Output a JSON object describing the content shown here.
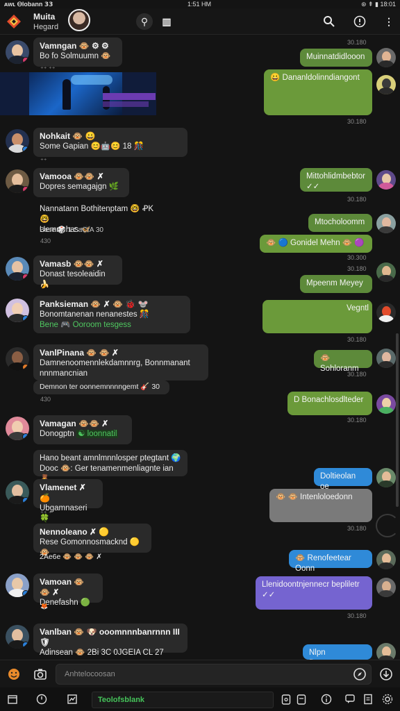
{
  "status": {
    "left": "ᴀᴡʟ Ꮎlobann 𝟯𝟯",
    "center": "1:51 ΗΜ",
    "right": "⊛ ⇞ ▮ 18:01"
  },
  "header": {
    "title": "Muita",
    "subtitle": "Hegard"
  },
  "incoming": [
    {
      "name": "Vamngan 🐵 ⚙ ⚙",
      "text": "Bo fo Solmuumn 🐵",
      "meta": "⁺⁺ ⁺⁺"
    },
    {
      "name": "Nohkait 🐵 😀",
      "text": "Some Gapian 😊🤖😊 18 🎊",
      "meta": "⁺⁺"
    },
    {
      "name": "Vamooa 🐵🐵 ✗",
      "text": "Dopres semagajgn 🌿",
      "meta": ""
    },
    {
      "name": "Nannatann Bothitenptam 🤓 ꝒK 🤓",
      "text": "Uemre has 🦋",
      "extra": "Base 🎲 1 SaCrA 30",
      "meta": "430"
    },
    {
      "name": "Vamasb 🐵🐵 ✗",
      "text": "Donast tesoleaidin 🍌",
      "meta": ""
    },
    {
      "name": "Panksieman 🐵 ✗ 🐵 🐞 🐭",
      "text": "Bonomtanenan nenanestes 🎊",
      "link": "Bene 🎮 Ooroom tesgess",
      "meta": ""
    },
    {
      "name": "VanlPinana 🐵 🐵 ✗",
      "text": "Damnenoomennlekdamnnrg, Bonnmanant",
      "text2": "nnnmancnian",
      "extra": "Demnon ter oonnemnnnngemt 🎸 30",
      "meta": "430"
    },
    {
      "name": "Vamagan 🐵🐵 ✗",
      "text": "Donogptn",
      "link": "☯ loonnatil",
      "meta": ""
    },
    {
      "name": "",
      "text": "Hano beant amnlmnnlosper ptegtant 🌍",
      "text2": "Dooc 🐵: Ger tenamenmenliagnte ian 🧸",
      "meta": ""
    },
    {
      "name": "Vlamenet ✗ 🍊",
      "text": "Ubgamnaseri 🍀",
      "meta": "⁺⁺ ⁺"
    },
    {
      "name": "Nennoleano ✗ 🟡",
      "text": "Rese Gomonnosmacknd 🟡 🐵",
      "extra": "2Ae6e 🐵 🐵 🐵 ✗",
      "meta": ""
    },
    {
      "name": "Vamoan 🐵 🐵 ✗",
      "text": "Denefashn 🟢",
      "meta": "🦊"
    },
    {
      "name": "Vanlban 🐵 🐶 ooomnnnbanrnnn III 🛡",
      "text": "Adinsean 🐵 2Bi 3C 0JGEIA CL 27",
      "meta": ""
    }
  ],
  "outgoing": [
    {
      "text": "Muinnatdidlooon",
      "time": "30.180"
    },
    {
      "text": "😀 Dananldolinndiangont",
      "time": "30.180"
    },
    {
      "text": "Mittohlidmbebtor ✓✓",
      "time": "30.180"
    },
    {
      "text": "Mtocholoomm",
      "time": ""
    },
    {
      "text": "🐵 🔵 Gonidel Mehn 🐵 🟣",
      "time": "30.300"
    },
    {
      "text": "Mpeenm Meyey",
      "time": "30.180"
    },
    {
      "text": "Vegntl",
      "time": "30.180"
    },
    {
      "text": "🐵 Sohloranm",
      "time": "30.180"
    },
    {
      "text": "D Bonachlosdlteder",
      "time": "30.180"
    },
    {
      "text": "Doltieolan oe",
      "time": ""
    },
    {
      "text": "🐵 🐵 Intenloloedonn",
      "time": "30.180"
    },
    {
      "text": "🐵 Renofeetear Oonn",
      "time": ""
    },
    {
      "text": "Llenidoontnjennecr bepliletr ✓✓",
      "time": "30.180"
    },
    {
      "text": "Nlpn Doomnmeenner",
      "time": ""
    }
  ],
  "composer": {
    "placeholder": "Anhtelocoosan"
  },
  "quick_bar": {
    "label": "Teolofsblank"
  },
  "colors": {
    "green": "#6b9a3a",
    "blue": "#2f8ad8",
    "purple": "#7564d0",
    "grey": "#7a7a7a",
    "incoming": "#2a2a2a",
    "background": "#141414"
  }
}
